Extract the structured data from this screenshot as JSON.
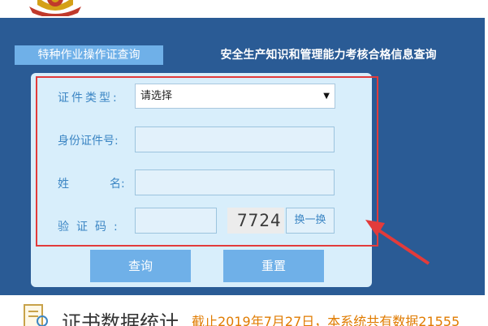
{
  "tabs": {
    "active_label": "特种作业操作证查询",
    "inactive_label": "安全生产知识和管理能力考核合格信息查询"
  },
  "form": {
    "cert_type_label": "证件类型:",
    "cert_type_value": "请选择",
    "id_label": "身份证件号:",
    "name_label_first": "姓",
    "name_label_second": "名:",
    "code_label": "验证码:",
    "captcha_text": "7724",
    "refresh_label": "换一换"
  },
  "buttons": {
    "query_label": "查询",
    "reset_label": "重置"
  },
  "stats": {
    "title": "证书数据统计",
    "note": "截止2019年7月27日，本系统共有数据21555"
  },
  "colors": {
    "band": "#2a5b95",
    "accent_blue": "#6fb0e8",
    "highlight_red": "#e23b3b",
    "note_orange": "#e07b00"
  }
}
